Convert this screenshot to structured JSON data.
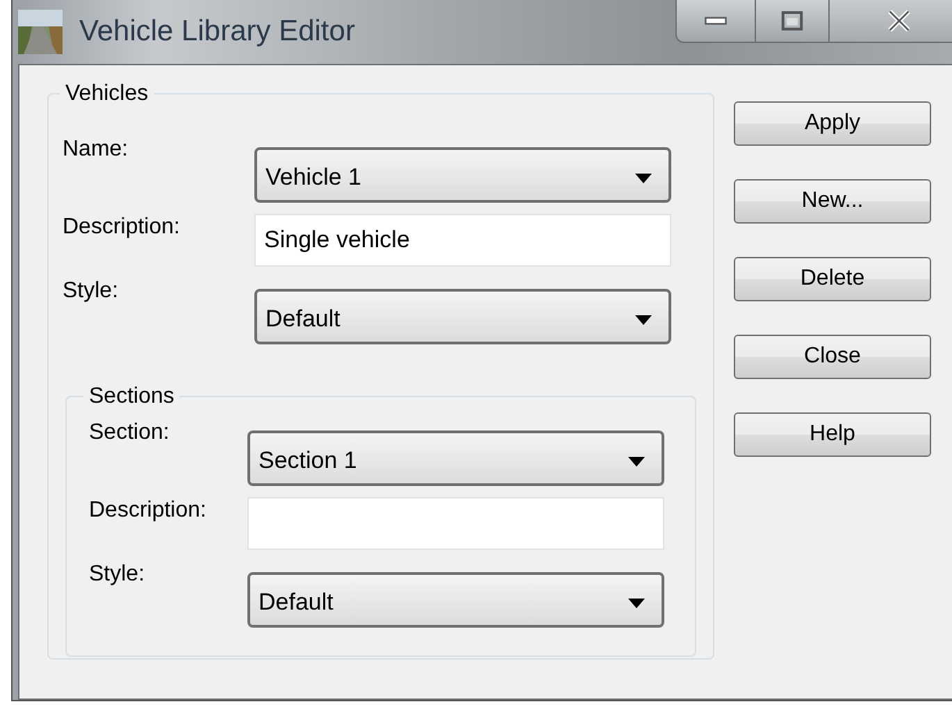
{
  "window": {
    "title": "Vehicle Library Editor",
    "caption_buttons": [
      {
        "kind": "minimize"
      },
      {
        "kind": "maximize"
      },
      {
        "kind": "close"
      }
    ]
  },
  "vehicles": {
    "title": "Vehicles",
    "fields": [
      {
        "kind": "dropdown",
        "label": "Name:",
        "value": "Vehicle 1"
      },
      {
        "kind": "text",
        "label": "Description:",
        "value": "Single vehicle"
      },
      {
        "kind": "dropdown",
        "label": "Style:",
        "value": "Default"
      }
    ],
    "sections": {
      "title": "Sections",
      "fields": [
        {
          "kind": "dropdown",
          "label": "Section:",
          "value": "Section 1"
        },
        {
          "kind": "text",
          "label": "Description:"
        },
        {
          "kind": "dropdown",
          "label": "Style:",
          "value": "Default"
        }
      ]
    }
  },
  "buttons": [
    "Apply",
    "New...",
    "Delete",
    "Close",
    "Help"
  ]
}
